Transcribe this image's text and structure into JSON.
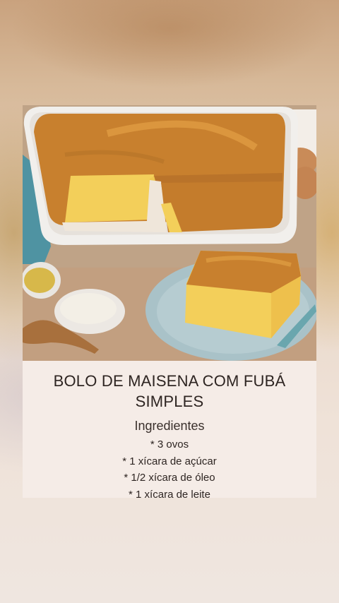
{
  "recipe": {
    "title": "BOLO DE MAISENA COM FUBÁ SIMPLES",
    "section_heading": "Ingredientes",
    "ingredients": [
      "* 3 ovos",
      "* 1 xícara de açúcar",
      "* 1/2 xícara de óleo",
      "* 1 xícara de leite"
    ]
  },
  "colors": {
    "cake_crust": "#c8802e",
    "cake_crumb": "#f3cf5a",
    "pan": "#f1efec",
    "plate": "#a9c2c8",
    "card_background": "#f5ece7",
    "text": "#2e2522"
  },
  "image": {
    "subject": "corn cake in baking dish with slice on plate"
  }
}
